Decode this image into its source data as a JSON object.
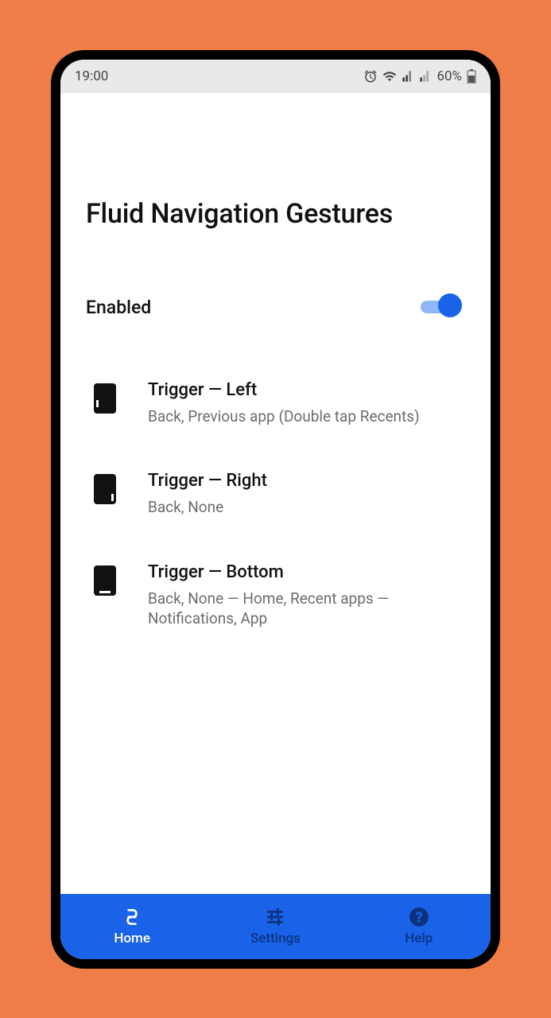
{
  "status": {
    "time": "19:00",
    "battery_percent": "60%"
  },
  "page": {
    "title": "Fluid Navigation Gestures",
    "enabled_label": "Enabled",
    "enabled_state": true
  },
  "triggers": [
    {
      "title": "Trigger — Left",
      "subtitle": "Back, Previous app (Double tap Recents)"
    },
    {
      "title": "Trigger — Right",
      "subtitle": "Back, None"
    },
    {
      "title": "Trigger — Bottom",
      "subtitle": "Back, None — Home, Recent apps — Notifications, App"
    }
  ],
  "nav": {
    "home": "Home",
    "settings": "Settings",
    "help": "Help"
  }
}
